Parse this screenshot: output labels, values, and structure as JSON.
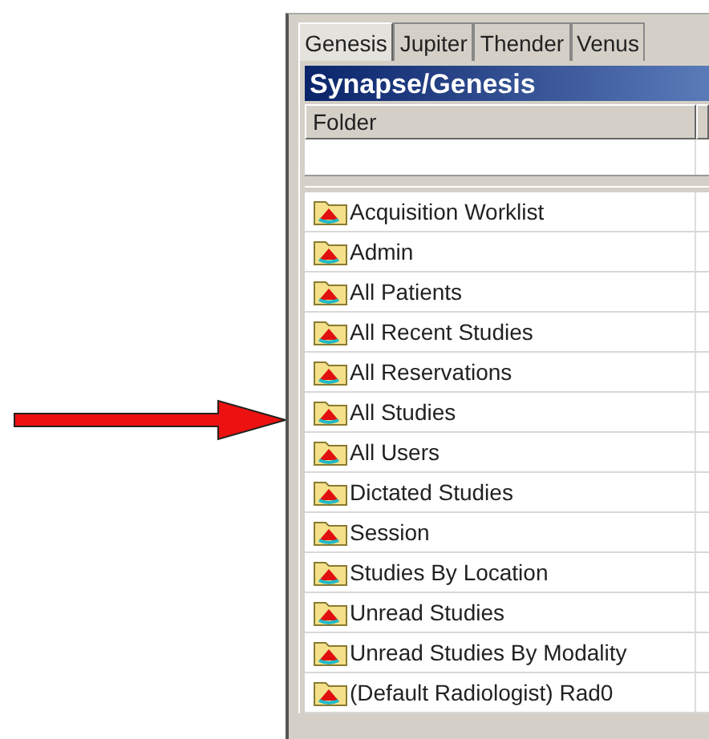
{
  "tabs": [
    {
      "label": "Genesis",
      "selected": true
    },
    {
      "label": "Jupiter",
      "selected": false
    },
    {
      "label": "Thender",
      "selected": false
    },
    {
      "label": "Venus",
      "selected": false
    }
  ],
  "panel_title": "Synapse/Genesis",
  "table": {
    "columns": [
      "Folder"
    ],
    "rows": [
      "Acquisition Worklist",
      "Admin",
      "All Patients",
      "All Recent Studies",
      "All Reservations",
      "All Studies",
      "All Users",
      "Dictated Studies",
      "Session",
      "Studies By Location",
      "Unread Studies",
      "Unread Studies By Modality",
      "(Default Radiologist) Rad0"
    ]
  }
}
